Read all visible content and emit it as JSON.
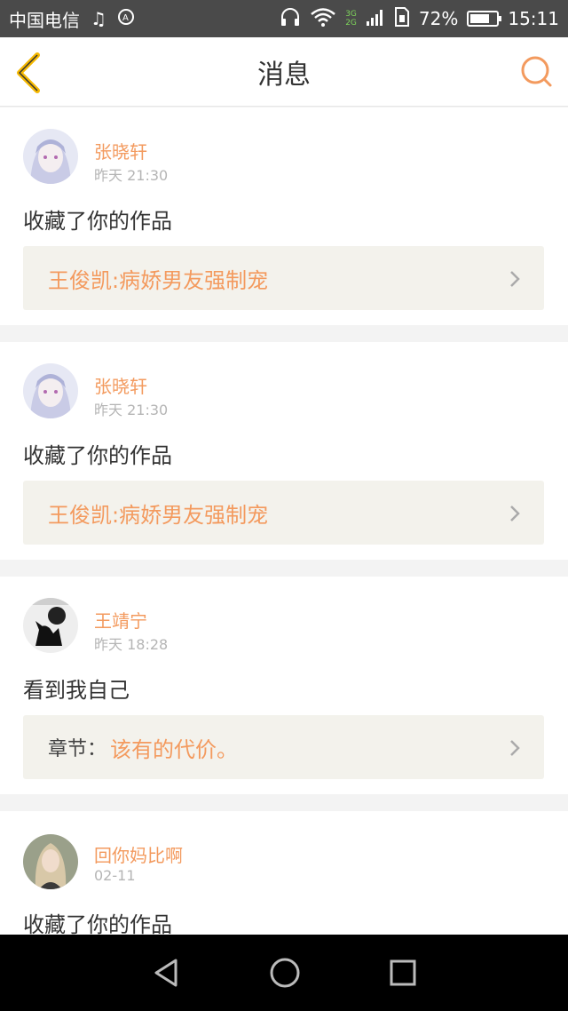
{
  "status_bar": {
    "carrier": "中国电信",
    "network_top": "3G",
    "network_bottom": "2G",
    "battery": "72%",
    "battery_level": 0.72,
    "time": "15:11"
  },
  "header": {
    "title": "消息"
  },
  "messages": [
    {
      "user": "张晓轩",
      "time": "昨天 21:30",
      "text": "收藏了你的作品",
      "work_prefix": "",
      "work_title": "王俊凯:病娇男友强制宠"
    },
    {
      "user": "张晓轩",
      "time": "昨天 21:30",
      "text": "收藏了你的作品",
      "work_prefix": "",
      "work_title": "王俊凯:病娇男友强制宠"
    },
    {
      "user": "王靖宁",
      "time": "昨天 18:28",
      "text": "看到我自己",
      "work_prefix": "章节：",
      "work_title": "该有的代价。"
    },
    {
      "user": "回你妈比啊",
      "time": "02-11",
      "text": "收藏了你的作品",
      "work_prefix": "",
      "work_title": ""
    }
  ],
  "colors": {
    "accent": "#f39a5e",
    "back_arrow": "#f5b800",
    "card_box": "#f3f2ec"
  }
}
